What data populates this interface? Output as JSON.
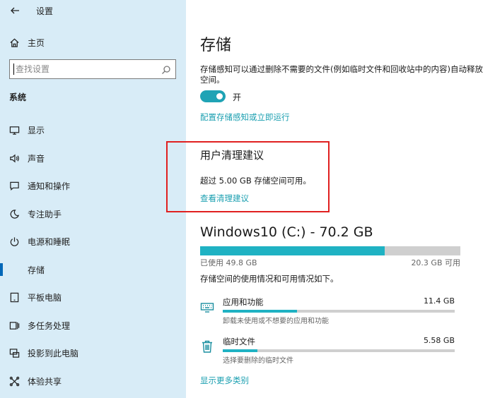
{
  "window": {
    "title": "设置"
  },
  "sidebar": {
    "home": "主页",
    "search_placeholder": "查找设置",
    "section": "系统",
    "items": [
      {
        "label": "显示",
        "icon": "monitor-icon"
      },
      {
        "label": "声音",
        "icon": "speaker-icon"
      },
      {
        "label": "通知和操作",
        "icon": "notification-icon"
      },
      {
        "label": "专注助手",
        "icon": "moon-icon"
      },
      {
        "label": "电源和睡眠",
        "icon": "power-icon"
      },
      {
        "label": "存储",
        "icon": "storage-icon",
        "active": true
      },
      {
        "label": "平板电脑",
        "icon": "tablet-icon"
      },
      {
        "label": "多任务处理",
        "icon": "multitask-icon"
      },
      {
        "label": "投影到此电脑",
        "icon": "projector-icon"
      },
      {
        "label": "体验共享",
        "icon": "share-icon"
      }
    ]
  },
  "main": {
    "title": "存储",
    "description": "存储感知可以通过删除不需要的文件(例如临时文件和回收站中的内容)自动释放空间。",
    "toggle": {
      "state": "开",
      "on": true
    },
    "configure_link": "配置存储感知或立即运行",
    "cleanup": {
      "heading": "用户清理建议",
      "text": "超过 5.00 GB 存储空间可用。",
      "link": "查看清理建议"
    },
    "drive": {
      "title": "Windows10 (C:) - 70.2 GB",
      "used": "已使用 49.8 GB",
      "free": "20.3 GB 可用",
      "used_fraction": 0.709
    },
    "usage_desc": "存储空间的使用情况和可用情况如下。",
    "categories": [
      {
        "name": "应用和功能",
        "size": "11.4 GB",
        "sub": "卸载未使用或不想要的应用和功能",
        "icon": "keyboard-icon",
        "fraction": 0.32
      },
      {
        "name": "临时文件",
        "size": "5.58 GB",
        "sub": "选择要删除的临时文件",
        "icon": "trash-icon",
        "fraction": 0.15
      }
    ],
    "more_link": "显示更多类别"
  },
  "colors": {
    "accent": "#1fb2c3",
    "link": "#1a9fb0",
    "sidebar": "#d8ecf7",
    "highlight": "#e02020"
  }
}
